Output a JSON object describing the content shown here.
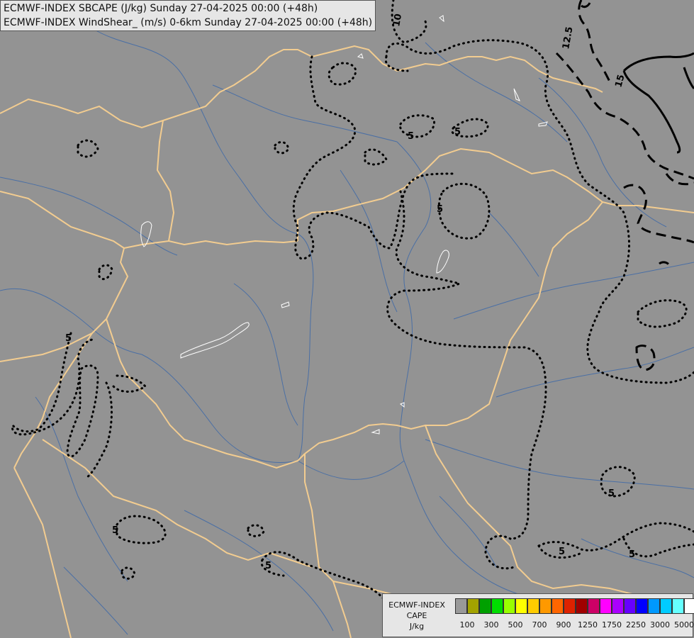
{
  "header": {
    "line1": "ECMWF-INDEX SBCAPE (J/kg) Sunday 27-04-2025 00:00 (+48h)",
    "line2": "ECMWF-INDEX WindShear_ (m/s) 0-6km Sunday 27-04-2025 00:00 (+48h)"
  },
  "legend": {
    "title1": "ECMWF-INDEX",
    "title2": "CAPE",
    "title3": "J/kg",
    "colors": [
      "#999999",
      "#a3a300",
      "#00a000",
      "#00dd00",
      "#99ff00",
      "#ffff00",
      "#ffcc00",
      "#ff9900",
      "#ff6600",
      "#dd2200",
      "#a00000",
      "#cc0066",
      "#ff00ff",
      "#aa00ff",
      "#6600ff",
      "#0000ff",
      "#0099ff",
      "#00ccff",
      "#66ffff",
      "#ffffff"
    ],
    "ticks": [
      "100",
      "300",
      "500",
      "700",
      "900",
      "1250",
      "1750",
      "2250",
      "3000",
      "5000"
    ]
  },
  "contour_labels": {
    "cape_10": "10",
    "cape_5": "5",
    "shear_125": "12.5",
    "shear_15": "15"
  },
  "map_colors": {
    "background": "#939393",
    "borders": "#f2cc90",
    "rivers": "#4a6fa5",
    "lakes": "#ffffff"
  }
}
